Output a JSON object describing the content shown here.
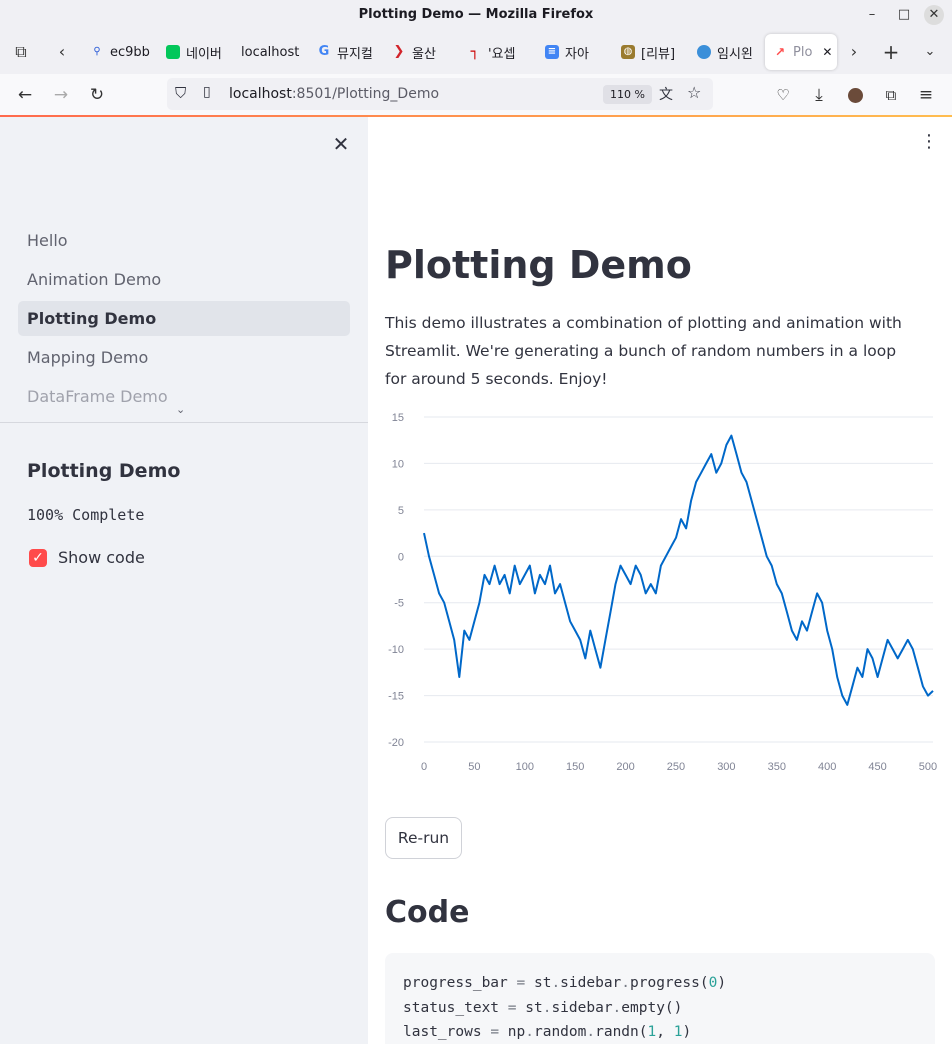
{
  "window": {
    "title": "Plotting Demo — Mozilla Firefox"
  },
  "tabs": [
    {
      "label": "ec9bb",
      "icon": "search-icon",
      "color": "#2a5bd7"
    },
    {
      "label": "네이버",
      "icon": "naver-icon",
      "color": "#03c75a"
    },
    {
      "label": "localhost",
      "icon": "",
      "color": ""
    },
    {
      "label": "뮤지컬",
      "icon": "google-icon",
      "color": "#4285f4"
    },
    {
      "label": "울산 ",
      "icon": "ulsan-icon",
      "color": "#d2232a"
    },
    {
      "label": "'요셉",
      "icon": "red-flag-icon",
      "color": "#cc0000"
    },
    {
      "label": "자아 ",
      "icon": "doc-icon",
      "color": "#4285f4"
    },
    {
      "label": "[리뷰]",
      "icon": "badge-icon",
      "color": "#9a7b2f"
    },
    {
      "label": "임시왼",
      "icon": "globe-icon",
      "color": "#3b8fd9"
    },
    {
      "label": "Plo",
      "icon": "chart-icon",
      "color": "#ff4b4b"
    }
  ],
  "navbar": {
    "url_host": "localhost",
    "url_rest": ":8501/Plotting_Demo",
    "zoom": "110 %"
  },
  "sidebar": {
    "nav": [
      {
        "label": "Hello"
      },
      {
        "label": "Animation Demo"
      },
      {
        "label": "Plotting Demo"
      },
      {
        "label": "Mapping Demo"
      },
      {
        "label": "DataFrame Demo"
      }
    ],
    "section_title": "Plotting Demo",
    "status": "100% Complete",
    "checkbox_label": "Show code"
  },
  "main": {
    "title": "Plotting Demo",
    "description": "This demo illustrates a combination of plotting and animation with Streamlit. We're generating a bunch of random numbers in a loop for around 5 seconds. Enjoy!",
    "rerun_label": "Re-run",
    "code_title": "Code",
    "code_lines": [
      "progress_bar = st.sidebar.progress(0)",
      "status_text = st.sidebar.empty()",
      "last_rows = np.random.randn(1, 1)"
    ]
  },
  "colors": {
    "accent": "#ff4b4b",
    "line": "#0068c9"
  },
  "chart_data": {
    "type": "line",
    "x_ticks": [
      0,
      50,
      100,
      150,
      200,
      250,
      300,
      350,
      400,
      450,
      500
    ],
    "y_ticks": [
      15,
      10,
      5,
      0,
      -5,
      -10,
      -15,
      -20
    ],
    "xlim": [
      0,
      505
    ],
    "ylim": [
      -20,
      15
    ],
    "grid": true,
    "series": [
      {
        "x": [
          0,
          5,
          10,
          15,
          20,
          25,
          30,
          35,
          40,
          45,
          50,
          55,
          60,
          65,
          70,
          75,
          80,
          85,
          90,
          95,
          100,
          105,
          110,
          115,
          120,
          125,
          130,
          135,
          140,
          145,
          150,
          155,
          160,
          165,
          170,
          175,
          180,
          185,
          190,
          195,
          200,
          205,
          210,
          215,
          220,
          225,
          230,
          235,
          240,
          245,
          250,
          255,
          260,
          265,
          270,
          275,
          280,
          285,
          290,
          295,
          300,
          305,
          310,
          315,
          320,
          325,
          330,
          335,
          340,
          345,
          350,
          355,
          360,
          365,
          370,
          375,
          380,
          385,
          390,
          395,
          400,
          405,
          410,
          415,
          420,
          425,
          430,
          435,
          440,
          445,
          450,
          455,
          460,
          465,
          470,
          475,
          480,
          485,
          490,
          495,
          500,
          505
        ],
        "y": [
          2.5,
          0,
          -2,
          -4,
          -5,
          -7,
          -9,
          -13,
          -8,
          -9,
          -7,
          -5,
          -2,
          -3,
          -1,
          -3,
          -2,
          -4,
          -1,
          -3,
          -2,
          -1,
          -4,
          -2,
          -3,
          -1,
          -4,
          -3,
          -5,
          -7,
          -8,
          -9,
          -11,
          -8,
          -10,
          -12,
          -9,
          -6,
          -3,
          -1,
          -2,
          -3,
          -1,
          -2,
          -4,
          -3,
          -4,
          -1,
          0,
          1,
          2,
          4,
          3,
          6,
          8,
          9,
          10,
          11,
          9,
          10,
          12,
          13,
          11,
          9,
          8,
          6,
          4,
          2,
          0,
          -1,
          -3,
          -4,
          -6,
          -8,
          -9,
          -7,
          -8,
          -6,
          -4,
          -5,
          -8,
          -10,
          -13,
          -15,
          -16,
          -14,
          -12,
          -13,
          -10,
          -11,
          -13,
          -11,
          -9,
          -10,
          -11,
          -10,
          -9,
          -10,
          -12,
          -14,
          -15,
          -14.5
        ]
      }
    ]
  }
}
